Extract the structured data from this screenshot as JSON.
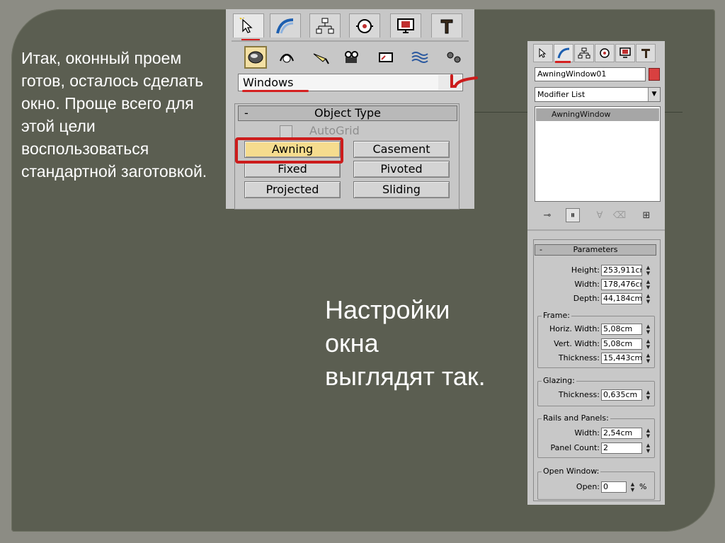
{
  "slide": {
    "main_text": "Итак, оконный проем готов, осталось сделать окно. Проще всего для этой цели воспользоваться стандартной заготовкой.",
    "caption": "Настройки окна выглядят так."
  },
  "create_panel": {
    "tabs": [
      "create-icon",
      "modify-icon",
      "hierarchy-icon",
      "motion-icon",
      "display-icon",
      "utilities-icon"
    ],
    "categories": [
      "geometry-icon",
      "shapes-icon",
      "lights-icon",
      "cameras-icon",
      "helpers-icon",
      "spacewarps-icon",
      "systems-icon"
    ],
    "dropdown_value": "Windows",
    "rollout_title": "Object Type",
    "rollout_minus": "-",
    "autogrid_label": "AutoGrid",
    "buttons": {
      "awning": "Awning",
      "casement": "Casement",
      "fixed": "Fixed",
      "pivoted": "Pivoted",
      "projected": "Projected",
      "sliding": "Sliding"
    },
    "highlight_color": "#cc1c1c"
  },
  "modify_panel": {
    "object_name": "AwningWindow01",
    "object_color": "#d84040",
    "modifier_list": "Modifier List",
    "stack_item": "AwningWindow",
    "parameters": {
      "title": "Parameters",
      "minus": "-",
      "height_label": "Height:",
      "height_value": "253,911cr",
      "width_label": "Width:",
      "width_value": "178,476cr",
      "depth_label": "Depth:",
      "depth_value": "44,184cm",
      "frame": {
        "title": "Frame:",
        "horiz_label": "Horiz. Width:",
        "horiz_value": "5,08cm",
        "vert_label": "Vert. Width:",
        "vert_value": "5,08cm",
        "thickness_label": "Thickness:",
        "thickness_value": "15,443cm"
      },
      "glazing": {
        "title": "Glazing:",
        "thickness_label": "Thickness:",
        "thickness_value": "0,635cm"
      },
      "rails": {
        "title": "Rails and Panels:",
        "width_label": "Width:",
        "width_value": "2,54cm",
        "count_label": "Panel Count:",
        "count_value": "2"
      },
      "open_window": {
        "title": "Open Window:",
        "open_label": "Open:",
        "open_value": "0",
        "unit": "%"
      }
    }
  }
}
